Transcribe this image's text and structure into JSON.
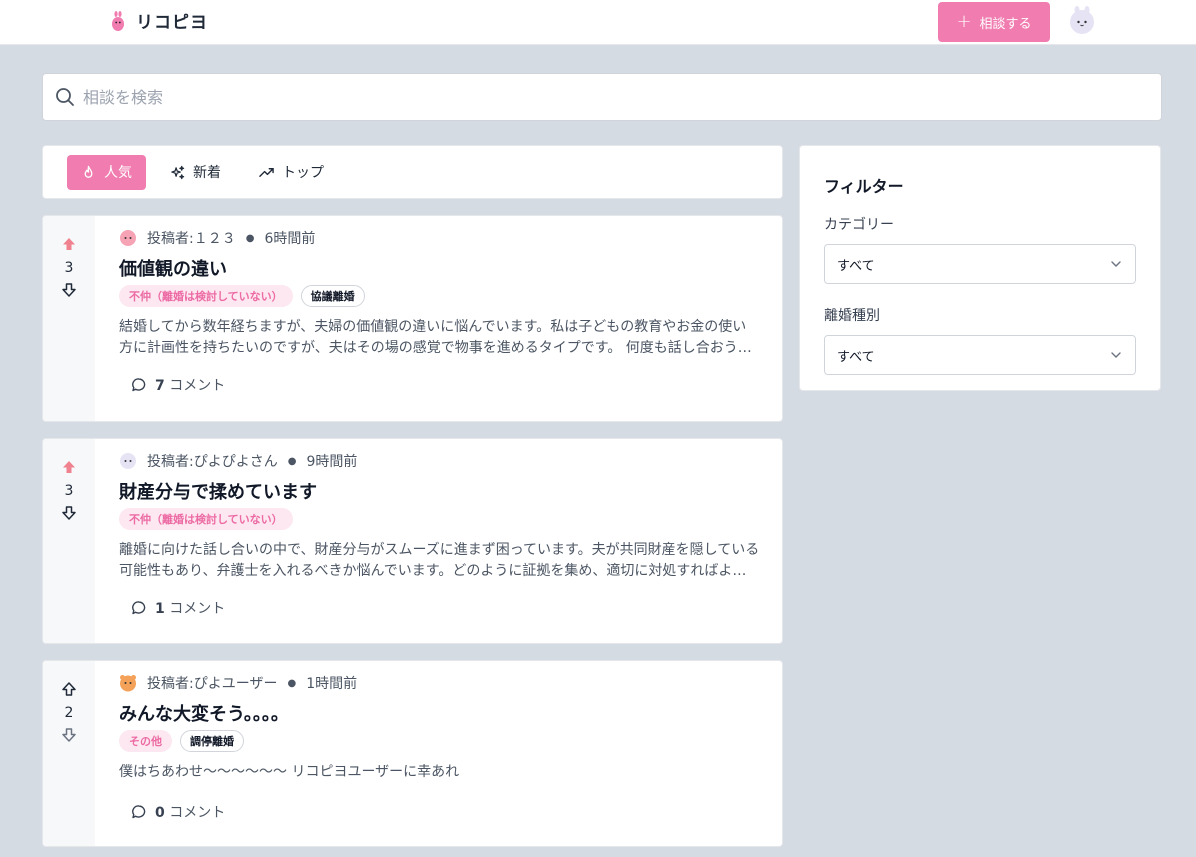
{
  "header": {
    "logo_text": "リコピヨ",
    "new_post_label": "相談する"
  },
  "search": {
    "placeholder": "相談を検索"
  },
  "tabs": [
    {
      "label": "人気",
      "icon": "flame-icon",
      "active": true
    },
    {
      "label": "新着",
      "icon": "sparkles-icon",
      "active": false
    },
    {
      "label": "トップ",
      "icon": "trending-up-icon",
      "active": false
    }
  ],
  "posts": [
    {
      "author_prefix": "投稿者: ",
      "author": "１２３",
      "time": "6時間前",
      "votes": "3",
      "upvoted": true,
      "title": "価値観の違い",
      "tags": [
        "不仲（離婚は検討していない）",
        "協議離婚"
      ],
      "excerpt": "結婚してから数年経ちますが、夫婦の価値観の違いに悩んでいます。私は子どもの教育やお金の使い方に計画性を持ちたいのですが、夫はその場の感覚で物事を進めるタイプです。 何度も話し合おうとしましたが、なかなか分かり合えません。",
      "comment_count": "7",
      "comment_label": "コメント"
    },
    {
      "author_prefix": "投稿者: ",
      "author": "ぴよぴよさん",
      "time": "9時間前",
      "votes": "3",
      "upvoted": true,
      "title": "財産分与で揉めています",
      "tags": [
        "不仲（離婚は検討していない）"
      ],
      "excerpt": "離婚に向けた話し合いの中で、財産分与がスムーズに進まず困っています。夫が共同財産を隠している可能性もあり、弁護士を入れるべきか悩んでいます。どのように証拠を集め、適切に対処すればよいのでしょうか。",
      "comment_count": "1",
      "comment_label": "コメント"
    },
    {
      "author_prefix": "投稿者: ",
      "author": "ぴよユーザー",
      "time": "1時間前",
      "votes": "2",
      "upvoted": false,
      "title": "みんな大変そう。。。。",
      "tags": [
        "その他",
        "調停離婚"
      ],
      "excerpt": "僕はちあわせ〜〜〜〜〜〜 リコピヨユーザーに幸あれ",
      "comment_count": "0",
      "comment_label": "コメント"
    }
  ],
  "filter": {
    "title": "フィルター",
    "category_label": "カテゴリー",
    "category_value": "すべて",
    "divorce_type_label": "離婚種別",
    "divorce_type_value": "すべて"
  },
  "colors": {
    "accent": "#f07cb0",
    "tag_bg": "#fde7f0",
    "tag_text": "#ec6ba4",
    "page_bg": "#d5dbe3"
  }
}
